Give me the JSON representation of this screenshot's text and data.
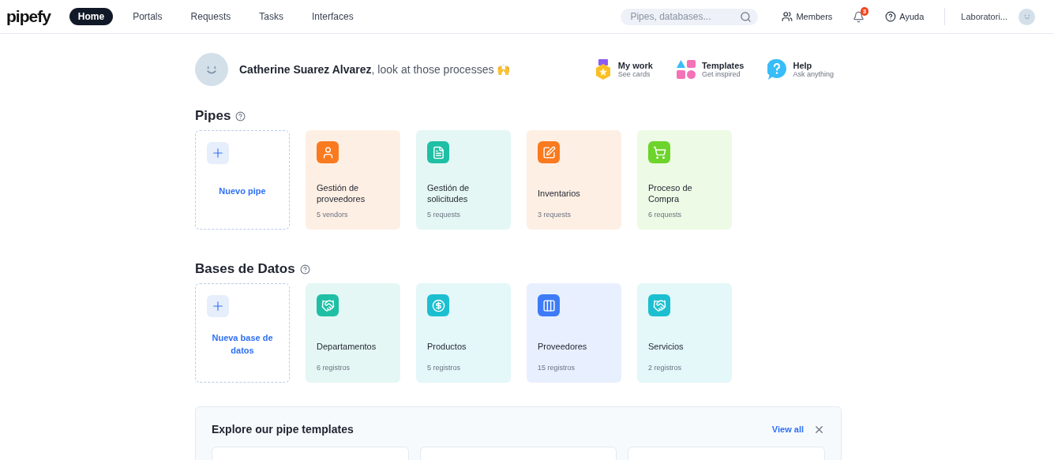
{
  "nav": {
    "logo": "pipefy",
    "tabs": [
      {
        "label": "Home",
        "selected": true
      },
      {
        "label": "Portals",
        "selected": false
      },
      {
        "label": "Requests",
        "selected": false
      },
      {
        "label": "Tasks",
        "selected": false
      },
      {
        "label": "Interfaces",
        "selected": false
      }
    ],
    "search": {
      "placeholder": "Pipes, databases..."
    },
    "members": "Members",
    "notifications": "3",
    "help": "Ayuda",
    "account": "Laboratori..."
  },
  "greeting": {
    "name": "Catherine Suarez Alvarez",
    "message": ", look at those processes 🙌"
  },
  "shortcuts": [
    {
      "title": "My work",
      "subtitle": "See cards"
    },
    {
      "title": "Templates",
      "subtitle": "Get inspired"
    },
    {
      "title": "Help",
      "subtitle": "Ask anything"
    }
  ],
  "sections": [
    {
      "title": "Pipes",
      "new_label": "Nuevo pipe",
      "items": [
        {
          "name": "Gestión de proveedores",
          "count": "5 vendors",
          "color": "#f97a1f"
        },
        {
          "name": "Gestión de solicitudes",
          "count": "5 requests",
          "color": "#1fbfa5"
        },
        {
          "name": "Inventarios",
          "count": "3 requests",
          "color": "#f97a1f"
        },
        {
          "name": "Proceso de Compra",
          "count": "6 requests",
          "color": "#6cd42a"
        }
      ]
    },
    {
      "title": "Bases de Datos",
      "new_label": "Nueva base de datos",
      "items": [
        {
          "name": "Departamentos",
          "count": "6 registros",
          "color": "#1fbfa5"
        },
        {
          "name": "Productos",
          "count": "5 registros",
          "color": "#1cbfd0"
        },
        {
          "name": "Proveedores",
          "count": "15 registros",
          "color": "#3d7cf6"
        },
        {
          "name": "Servicios",
          "count": "2 registros",
          "color": "#1cbfd0"
        }
      ]
    }
  ],
  "templates": {
    "title": "Explore our pipe templates",
    "view_all": "View all"
  }
}
